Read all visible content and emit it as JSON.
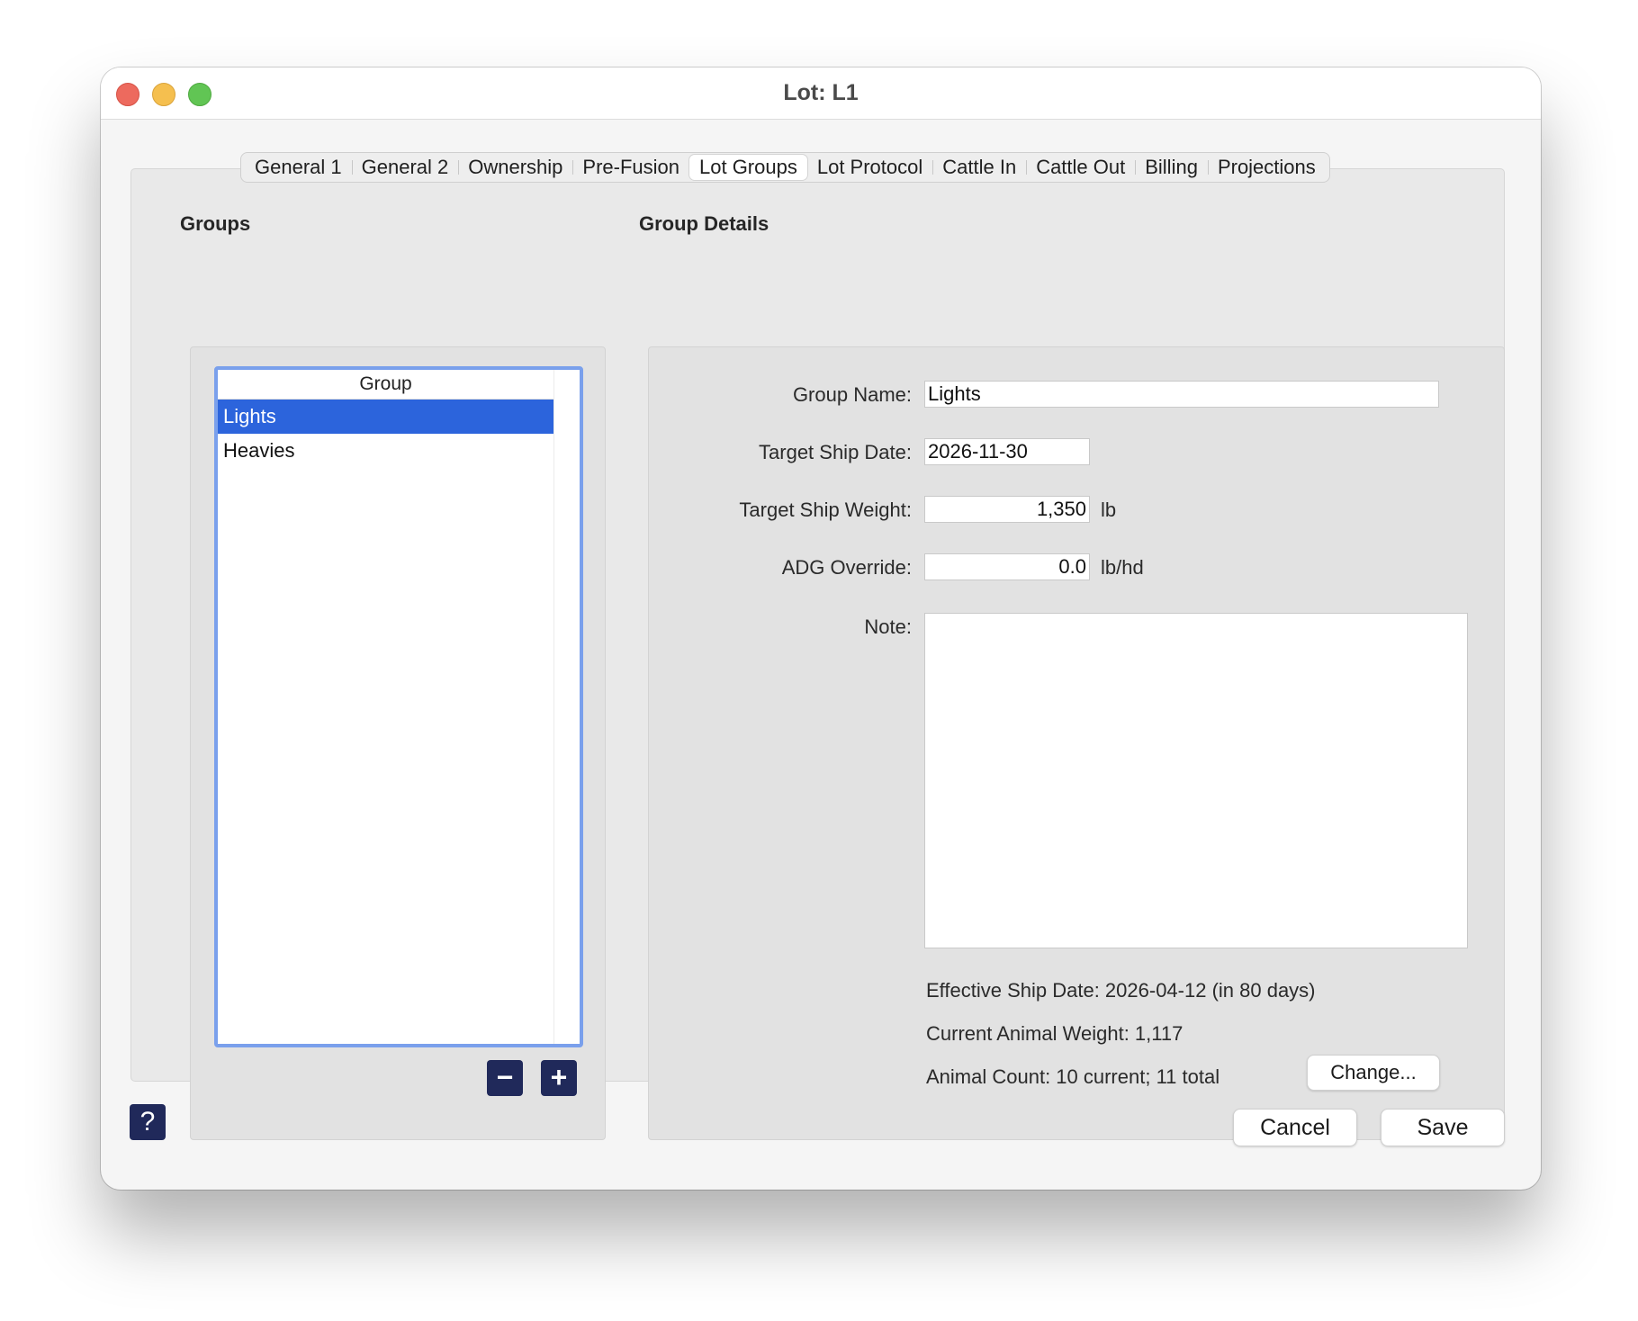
{
  "window": {
    "title": "Lot: L1"
  },
  "tabs": [
    {
      "label": "General 1"
    },
    {
      "label": "General 2"
    },
    {
      "label": "Ownership"
    },
    {
      "label": "Pre-Fusion"
    },
    {
      "label": "Lot Groups",
      "active": true
    },
    {
      "label": "Lot Protocol"
    },
    {
      "label": "Cattle In"
    },
    {
      "label": "Cattle Out"
    },
    {
      "label": "Billing"
    },
    {
      "label": "Projections"
    }
  ],
  "groups": {
    "section_label": "Groups",
    "column_header": "Group",
    "rows": [
      {
        "name": "Lights",
        "selected": true
      },
      {
        "name": "Heavies",
        "selected": false
      }
    ],
    "remove_label": "−",
    "add_label": "+"
  },
  "details": {
    "section_label": "Group Details",
    "group_name_label": "Group Name:",
    "group_name_value": "Lights",
    "target_ship_date_label": "Target Ship Date:",
    "target_ship_date_value": "2026-11-30",
    "target_ship_weight_label": "Target Ship Weight:",
    "target_ship_weight_value": "1,350",
    "target_ship_weight_unit": "lb",
    "adg_override_label": "ADG Override:",
    "adg_override_value": "0.0",
    "adg_override_unit": "lb/hd",
    "note_label": "Note:",
    "note_value": "",
    "effective_ship_date": "Effective Ship Date: 2026-04-12 (in 80 days)",
    "current_animal_weight": "Current Animal Weight: 1,117",
    "animal_count": "Animal Count: 10 current; 11 total",
    "change_label": "Change..."
  },
  "footer": {
    "help_label": "?",
    "cancel_label": "Cancel",
    "save_label": "Save"
  },
  "colors": {
    "selection": "#2c64dc",
    "focus_ring": "#7aa0ec",
    "square_button": "#20295a"
  }
}
